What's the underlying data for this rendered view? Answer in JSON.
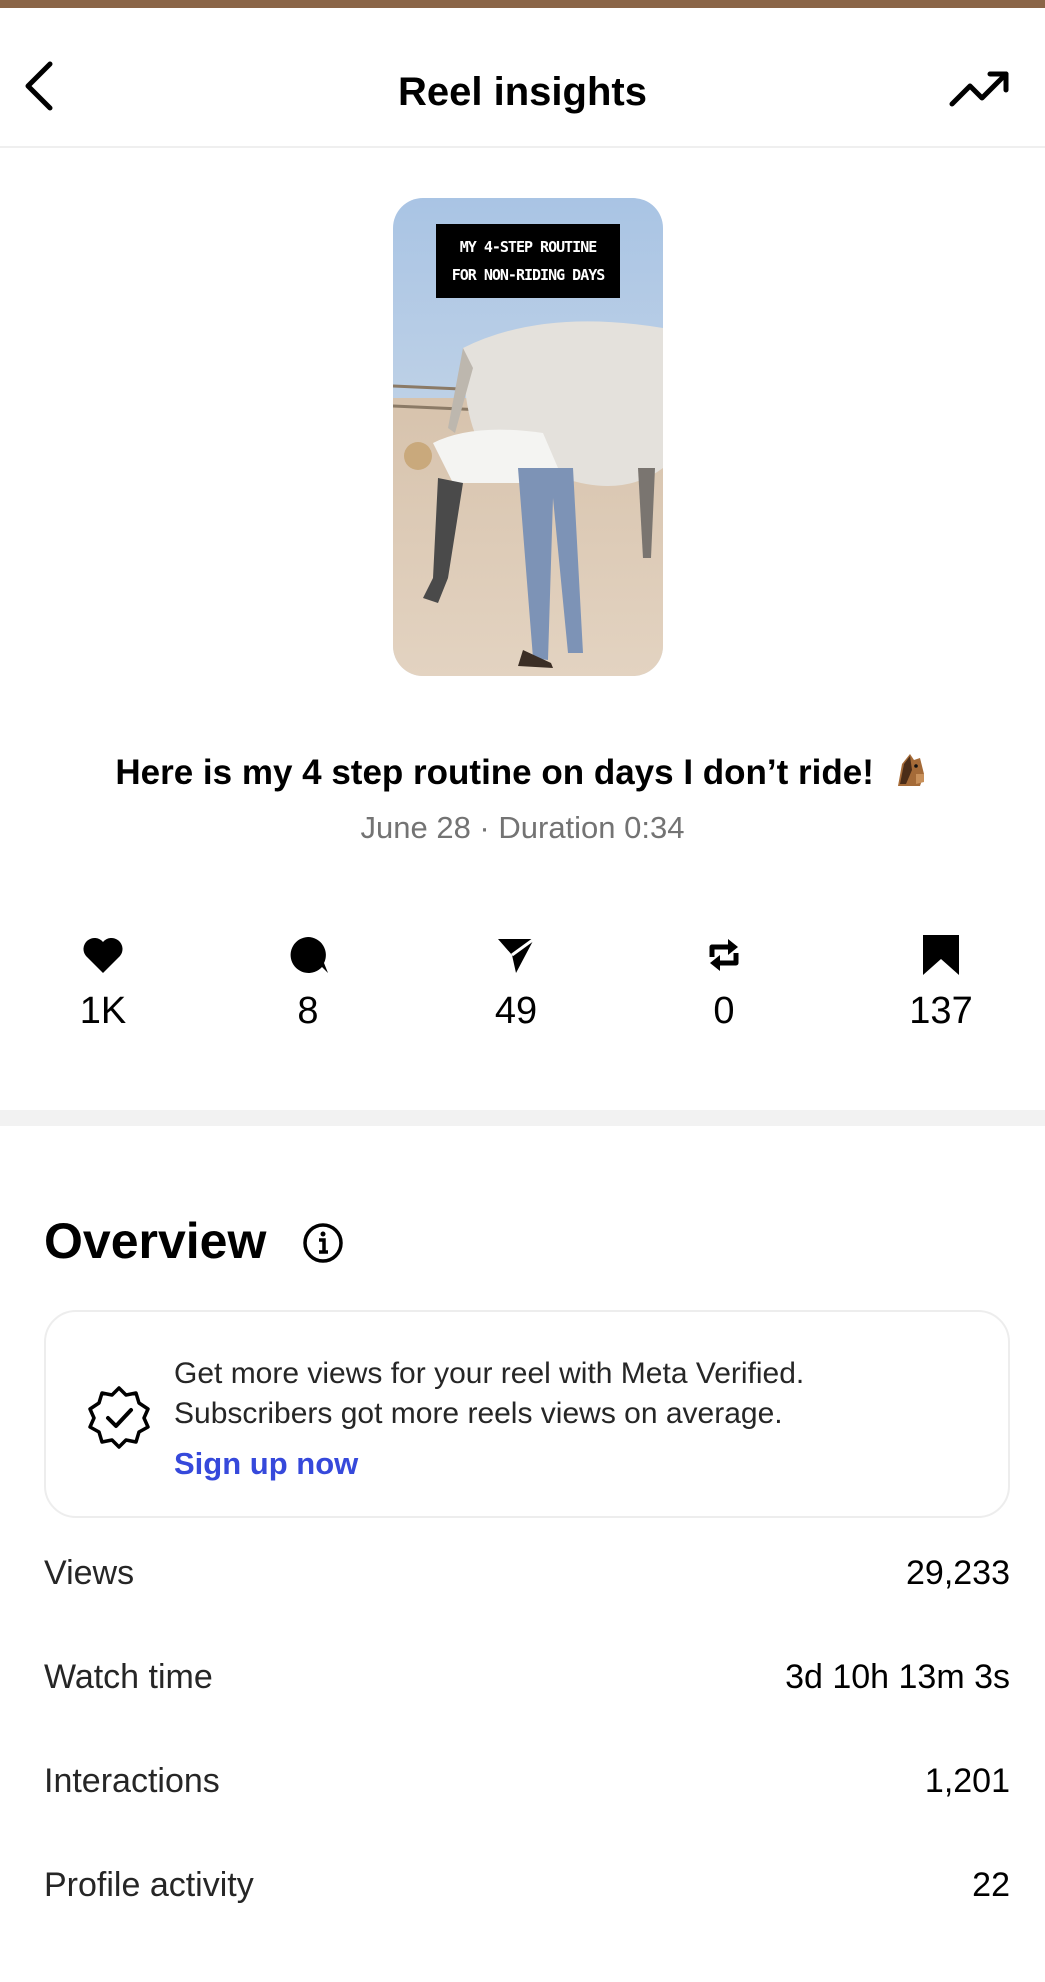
{
  "header": {
    "title": "Reel insights",
    "back_icon": "chevron-left-icon",
    "trend_icon": "trending-up-icon"
  },
  "reel": {
    "overlay_line1": "MY 4-STEP ROUTINE",
    "overlay_line2": "FOR NON-RIDING DAYS",
    "caption": "Here is my 4 step routine on days I don’t ride!",
    "caption_emoji": "horse-face-emoji",
    "date_duration": "June 28 · Duration 0:34"
  },
  "stats": [
    {
      "icon": "heart-icon",
      "value": "1K"
    },
    {
      "icon": "comment-icon",
      "value": "8"
    },
    {
      "icon": "share-icon",
      "value": "49"
    },
    {
      "icon": "repost-icon",
      "value": "0"
    },
    {
      "icon": "bookmark-icon",
      "value": "137"
    }
  ],
  "overview": {
    "title": "Overview",
    "info_icon": "info-icon",
    "promo": {
      "line1": "Get more views for your reel with Meta Verified.",
      "line2": "Subscribers got more reels views on average.",
      "cta": "Sign up now",
      "cta_color": "#3649db",
      "icon": "verified-badge-icon"
    },
    "rows": [
      {
        "label": "Views",
        "value": "29,233"
      },
      {
        "label": "Watch time",
        "value": "3d 10h 13m 3s"
      },
      {
        "label": "Interactions",
        "value": "1,201"
      },
      {
        "label": "Profile activity",
        "value": "22"
      }
    ]
  }
}
